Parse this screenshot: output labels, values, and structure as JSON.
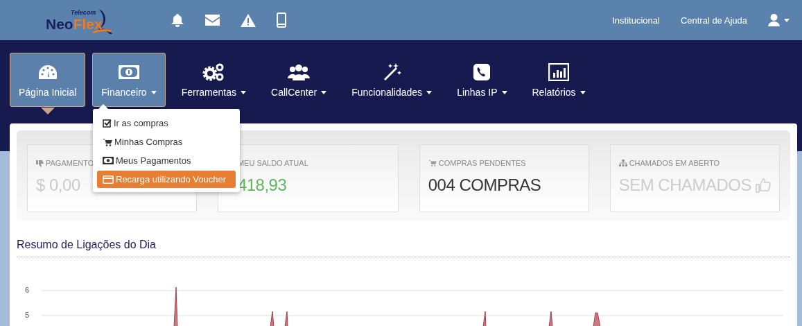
{
  "header": {
    "logo_small": "Telecom",
    "logo_part1": "Neo",
    "logo_part2": "Flex",
    "links": [
      "Institucional",
      "Central de Ajuda"
    ]
  },
  "nav": [
    {
      "label": "Página Inicial",
      "selected": true,
      "expanded": false,
      "dropdown": false
    },
    {
      "label": "Financeiro",
      "selected": false,
      "expanded": true,
      "dropdown": true
    },
    {
      "label": "Ferramentas",
      "selected": false,
      "expanded": false,
      "dropdown": true
    },
    {
      "label": "CallCenter",
      "selected": false,
      "expanded": false,
      "dropdown": true
    },
    {
      "label": "Funcionalidades",
      "selected": false,
      "expanded": false,
      "dropdown": true
    },
    {
      "label": "Linhas IP",
      "selected": false,
      "expanded": false,
      "dropdown": true
    },
    {
      "label": "Relatórios",
      "selected": false,
      "expanded": false,
      "dropdown": true
    }
  ],
  "dropdown_menu": [
    {
      "label": "Ir as compras",
      "selected": false
    },
    {
      "label": "Minhas Compras",
      "selected": false
    },
    {
      "label": "Meus Pagamentos",
      "selected": false
    },
    {
      "label": "Recarga utilizando Voucher",
      "selected": true
    }
  ],
  "stats": [
    {
      "label": "PAGAMENTO",
      "value": "$ 0,00",
      "color": "#cccccc"
    },
    {
      "label": "MEU SALDO ATUAL",
      "value": "418,93",
      "color": "#5cb85c"
    },
    {
      "label": "COMPRAS PENDENTES",
      "value": "004 COMPRAS",
      "color": "#333333"
    },
    {
      "label": "CHAMADOS EM ABERTO",
      "value": "SEM CHAMADOS",
      "color": "#cccccc"
    }
  ],
  "chart": {
    "title": "Resumo de Ligações do Dia",
    "yticks": [
      "6",
      "5"
    ]
  }
}
